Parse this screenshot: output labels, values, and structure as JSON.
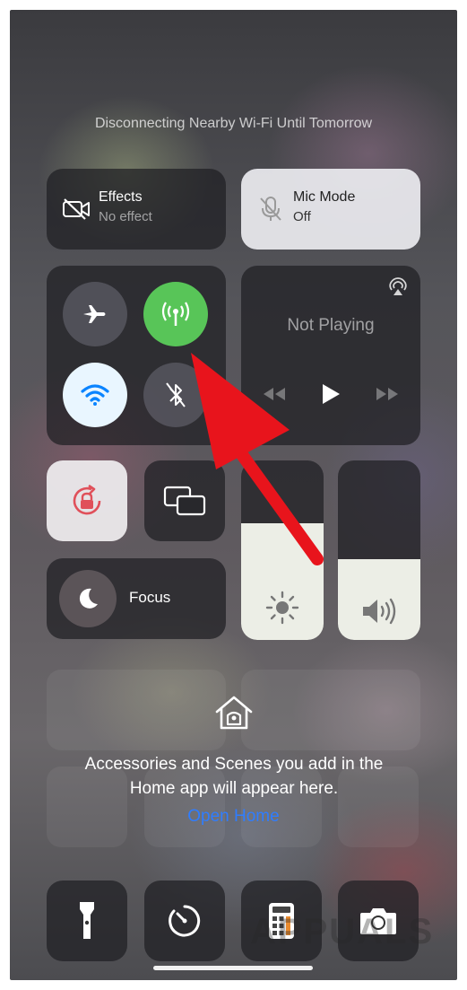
{
  "status_message": "Disconnecting Nearby Wi-Fi Until Tomorrow",
  "effects": {
    "title": "Effects",
    "subtitle": "No effect",
    "icon": "video-off-icon"
  },
  "mic_mode": {
    "title": "Mic Mode",
    "subtitle": "Off",
    "icon": "mic-off-icon"
  },
  "connectivity": {
    "airplane": {
      "icon": "airplane-icon",
      "on": false
    },
    "cellular": {
      "icon": "cellular-antenna-icon",
      "on": true,
      "color": "#58c558"
    },
    "wifi": {
      "icon": "wifi-icon",
      "on": true
    },
    "bluetooth": {
      "icon": "bluetooth-off-icon",
      "on": false
    }
  },
  "now_playing": {
    "title": "Not Playing",
    "icons": [
      "airplay-icon",
      "rewind-icon",
      "play-icon",
      "fast-forward-icon"
    ]
  },
  "orientation_lock": {
    "icon": "rotation-lock-icon",
    "on": true,
    "color": "#e0505a"
  },
  "screen_mirroring": {
    "icon": "screen-mirroring-icon"
  },
  "focus": {
    "label": "Focus",
    "icon": "moon-icon"
  },
  "brightness": {
    "level": 0.65,
    "icon": "sun-icon"
  },
  "volume": {
    "level": 0.45,
    "icon": "speaker-icon"
  },
  "home": {
    "message_line1": "Accessories and Scenes you add in the",
    "message_line2": "Home app will appear here.",
    "link": "Open Home",
    "link_color": "#2f7dff"
  },
  "bottom_row": [
    "flashlight-icon",
    "timer-icon",
    "calculator-icon",
    "camera-icon"
  ],
  "watermark": "APPUALS",
  "annotation": {
    "color": "#e8141c",
    "points_to": "cellular-data-button"
  }
}
